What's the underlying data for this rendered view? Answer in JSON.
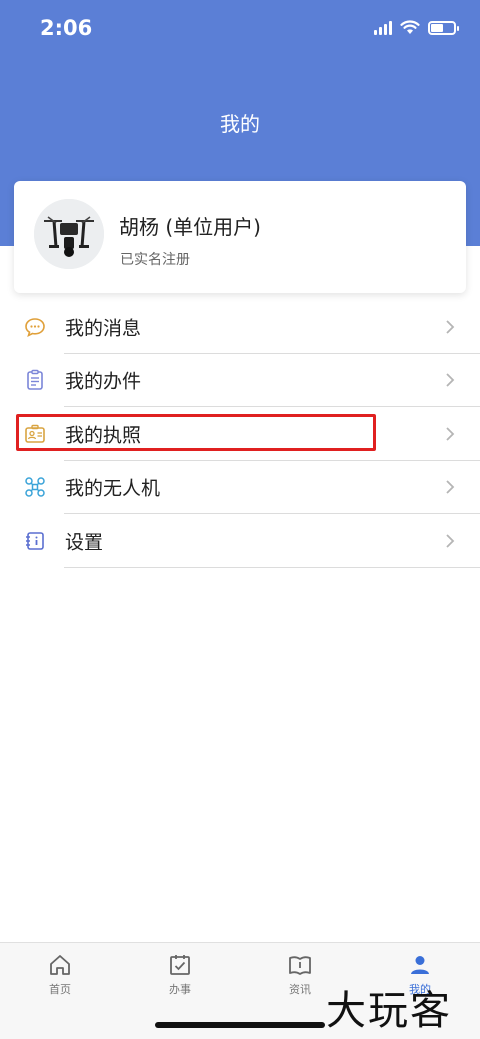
{
  "status_bar": {
    "time": "2:06"
  },
  "header": {
    "title": "我的"
  },
  "profile": {
    "name": "胡杨 (单位用户)",
    "status": "已实名注册"
  },
  "menu": {
    "items": [
      {
        "label": "我的消息",
        "icon": "message-icon"
      },
      {
        "label": "我的办件",
        "icon": "document-icon"
      },
      {
        "label": "我的执照",
        "icon": "license-icon"
      },
      {
        "label": "我的无人机",
        "icon": "drone-icon"
      },
      {
        "label": "设置",
        "icon": "settings-icon"
      }
    ]
  },
  "tabbar": {
    "tabs": [
      {
        "label": "首页",
        "icon": "home-icon"
      },
      {
        "label": "办事",
        "icon": "calendar-check-icon"
      },
      {
        "label": "资讯",
        "icon": "book-icon"
      },
      {
        "label": "我的",
        "icon": "user-icon"
      }
    ],
    "active": "我的"
  },
  "watermark": "大玩客",
  "colors": {
    "header_bg": "#5b7fd6",
    "highlight": "#e02020",
    "active_tab": "#3a6fd8"
  }
}
